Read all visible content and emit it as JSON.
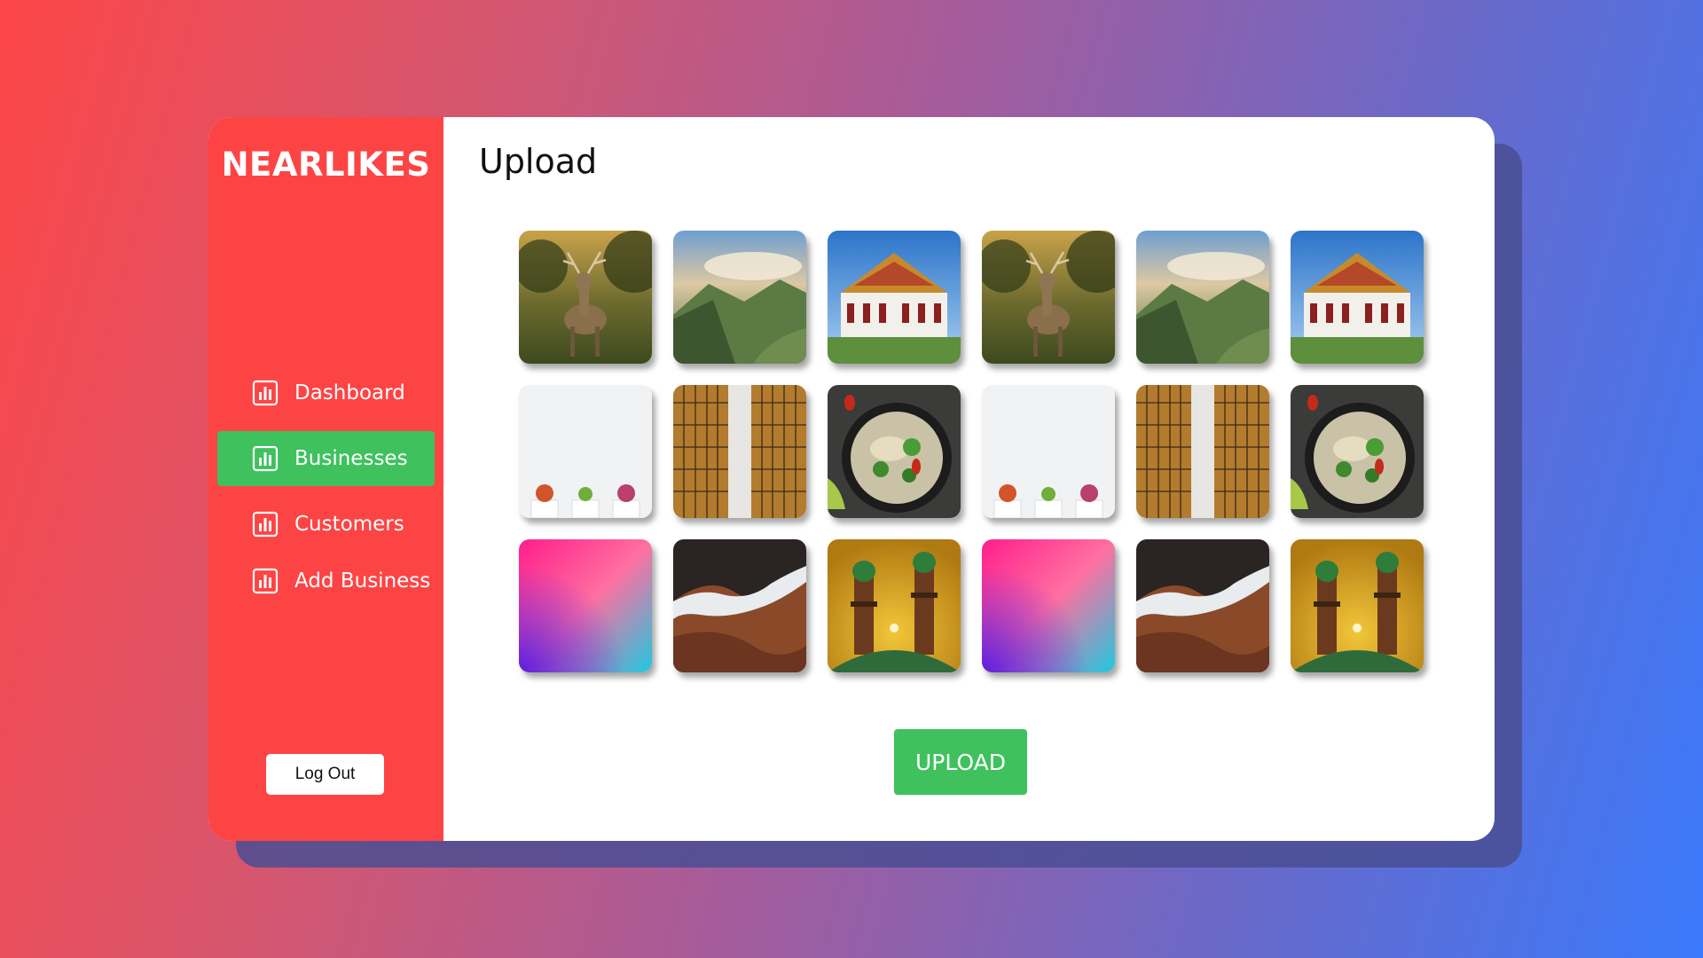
{
  "app": {
    "brand": "NEARLIKES"
  },
  "sidebar": {
    "items": [
      {
        "label": "Dashboard",
        "icon": "bar-chart-icon",
        "active": false
      },
      {
        "label": "Businesses",
        "icon": "bar-chart-icon",
        "active": true
      },
      {
        "label": "Customers",
        "icon": "bar-chart-icon",
        "active": false
      },
      {
        "label": "Add Business",
        "icon": "bar-chart-icon",
        "active": false
      }
    ],
    "logout_label": "Log Out"
  },
  "main": {
    "title": "Upload",
    "upload_label": "UPLOAD",
    "gallery": [
      "deer-photo",
      "mountain-clouds-photo",
      "temple-photo",
      "deer-photo",
      "mountain-clouds-photo",
      "temple-photo",
      "succulent-pots-photo",
      "skyscrapers-photo",
      "noodle-soup-photo",
      "succulent-pots-photo",
      "skyscrapers-photo",
      "noodle-soup-photo",
      "gradient-photo",
      "canyon-photo",
      "minaret-towers-photo",
      "gradient-photo",
      "canyon-photo",
      "minaret-towers-photo"
    ]
  },
  "colors": {
    "sidebar_bg": "#fd4445",
    "active_item": "#3fc15e",
    "upload_button": "#3fc15e",
    "card_bg": "#ffffff",
    "background_gradient_start": "#fd4648",
    "background_gradient_end": "#3a79fb"
  }
}
